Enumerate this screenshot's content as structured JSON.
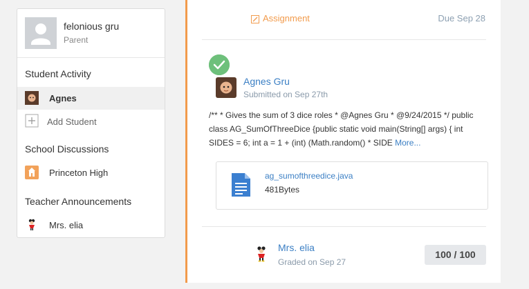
{
  "sidebar": {
    "user_name": "felonious gru",
    "user_role": "Parent",
    "student_activity_title": "Student Activity",
    "students": [
      {
        "label": "Agnes"
      }
    ],
    "add_student_label": "Add Student",
    "school_discussions_title": "School Discussions",
    "schools": [
      {
        "label": "Princeton High"
      }
    ],
    "teacher_announcements_title": "Teacher Announcements",
    "teachers": [
      {
        "label": "Mrs. elia"
      }
    ]
  },
  "main": {
    "assignment_label": "Assignment",
    "due_label": "Due Sep 28",
    "submission": {
      "name": "Agnes Gru",
      "date": "Submitted on Sep 27th",
      "body": "/** * Gives the sum of 3 dice roles * @Agnes Gru * @9/24/2015 */ public class AG_SumOfThreeDice {public static void main(String[] args) { int SIDES = 6; int a = 1 + (int) (Math.random() * SIDE ",
      "more_label": "More..."
    },
    "attachment": {
      "file_name": "ag_sumofthreedice.java",
      "file_size": "481Bytes"
    },
    "grade": {
      "grader_name": "Mrs. elia",
      "graded_date": "Graded on Sep 27",
      "score": "100 / 100"
    }
  },
  "colors": {
    "accent_orange": "#f29b4c",
    "link_blue": "#3b7fc4",
    "success_green": "#6ec07b"
  }
}
